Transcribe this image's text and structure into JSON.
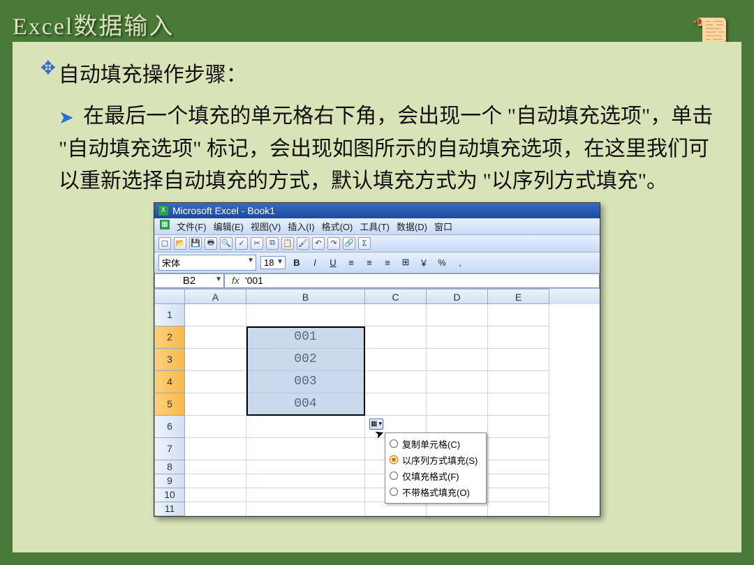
{
  "slide": {
    "title": "Excel数据输入",
    "heading": "自动填充操作步骤：",
    "paragraph": "在最后一个填充的单元格右下角，会出现一个 \"自动填充选项\"，单击 \"自动填充选项\" 标记，会出现如图所示的自动填充选项，在这里我们可以重新选择自动填充的方式，默认填充方式为 \"以序列方式填充\"。"
  },
  "excel": {
    "app_title": "Microsoft Excel - Book1",
    "menus": [
      "文件(F)",
      "编辑(E)",
      "视图(V)",
      "插入(I)",
      "格式(O)",
      "工具(T)",
      "数据(D)",
      "窗口"
    ],
    "font_name": "宋体",
    "font_size": "18",
    "format_buttons": {
      "bold": "B",
      "italic": "I",
      "underline": "U",
      "currency": "￥",
      "percent": "%",
      "comma": ","
    },
    "name_box": "B2",
    "fx_label": "fx",
    "formula_value": "'001",
    "columns": [
      "A",
      "B",
      "C",
      "D",
      "E"
    ],
    "rows": [
      {
        "num": "1",
        "h": "r-tall",
        "sel": false,
        "b": ""
      },
      {
        "num": "2",
        "h": "r-tall",
        "sel": true,
        "b": "001"
      },
      {
        "num": "3",
        "h": "r-tall",
        "sel": true,
        "b": "002"
      },
      {
        "num": "4",
        "h": "r-tall",
        "sel": true,
        "b": "003"
      },
      {
        "num": "5",
        "h": "r-tall",
        "sel": true,
        "b": "004"
      },
      {
        "num": "6",
        "h": "r-tall",
        "sel": false,
        "b": ""
      },
      {
        "num": "7",
        "h": "r-tall",
        "sel": false,
        "b": ""
      },
      {
        "num": "8",
        "h": "r-short",
        "sel": false,
        "b": ""
      },
      {
        "num": "9",
        "h": "r-short",
        "sel": false,
        "b": ""
      },
      {
        "num": "10",
        "h": "r-short",
        "sel": false,
        "b": ""
      },
      {
        "num": "11",
        "h": "r-short",
        "sel": false,
        "b": ""
      }
    ],
    "autofill_menu": [
      {
        "label": "复制单元格(C)",
        "checked": false
      },
      {
        "label": "以序列方式填充(S)",
        "checked": true
      },
      {
        "label": "仅填充格式(F)",
        "checked": false
      },
      {
        "label": "不带格式填充(O)",
        "checked": false
      }
    ]
  }
}
